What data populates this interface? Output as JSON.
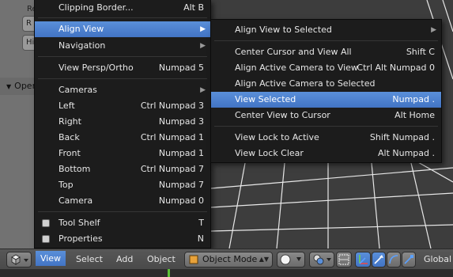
{
  "colors": {
    "menu_bg": "#1c1c1c",
    "highlight": "#5680c2",
    "viewport_bg": "#3d3d3d",
    "grid_line": "#e8e8e8",
    "frame_marker": "#5bc236"
  },
  "toolshelf": {
    "label_top": "Re",
    "btn1": "R",
    "btn2": "Hist",
    "panel_header": "Opera"
  },
  "view_menu": {
    "items": [
      {
        "label": "Clipping Border...",
        "shortcut": "Alt B"
      },
      {
        "label": "Align View",
        "submenu": true
      },
      {
        "label": "Navigation",
        "submenu": true
      },
      {
        "label": "View Persp/Ortho",
        "shortcut": "Numpad 5"
      },
      {
        "label": "Cameras",
        "submenu": true
      },
      {
        "label": "Left",
        "shortcut": "Ctrl Numpad 3"
      },
      {
        "label": "Right",
        "shortcut": "Numpad 3"
      },
      {
        "label": "Back",
        "shortcut": "Ctrl Numpad 1"
      },
      {
        "label": "Front",
        "shortcut": "Numpad 1"
      },
      {
        "label": "Bottom",
        "shortcut": "Ctrl Numpad 7"
      },
      {
        "label": "Top",
        "shortcut": "Numpad 7"
      },
      {
        "label": "Camera",
        "shortcut": "Numpad 0"
      },
      {
        "label": "Tool Shelf",
        "shortcut": "T",
        "checkbox": true
      },
      {
        "label": "Properties",
        "shortcut": "N",
        "checkbox": true
      }
    ]
  },
  "align_menu": {
    "items": [
      {
        "label": "Align View to Selected",
        "submenu": true
      },
      {
        "label": "Center Cursor and View All",
        "shortcut": "Shift C"
      },
      {
        "label": "Align Active Camera to View",
        "shortcut": "Ctrl Alt Numpad 0"
      },
      {
        "label": "Align Active Camera to Selected",
        "shortcut": ""
      },
      {
        "label": "View Selected",
        "shortcut": "Numpad ."
      },
      {
        "label": "Center View to Cursor",
        "shortcut": "Alt Home"
      },
      {
        "label": "View Lock to Active",
        "shortcut": "Shift Numpad ."
      },
      {
        "label": "View Lock Clear",
        "shortcut": "Alt Numpad ."
      }
    ]
  },
  "header": {
    "menus": [
      "View",
      "Select",
      "Add",
      "Object"
    ],
    "mode": "Object Mode",
    "orientation": "Global"
  }
}
